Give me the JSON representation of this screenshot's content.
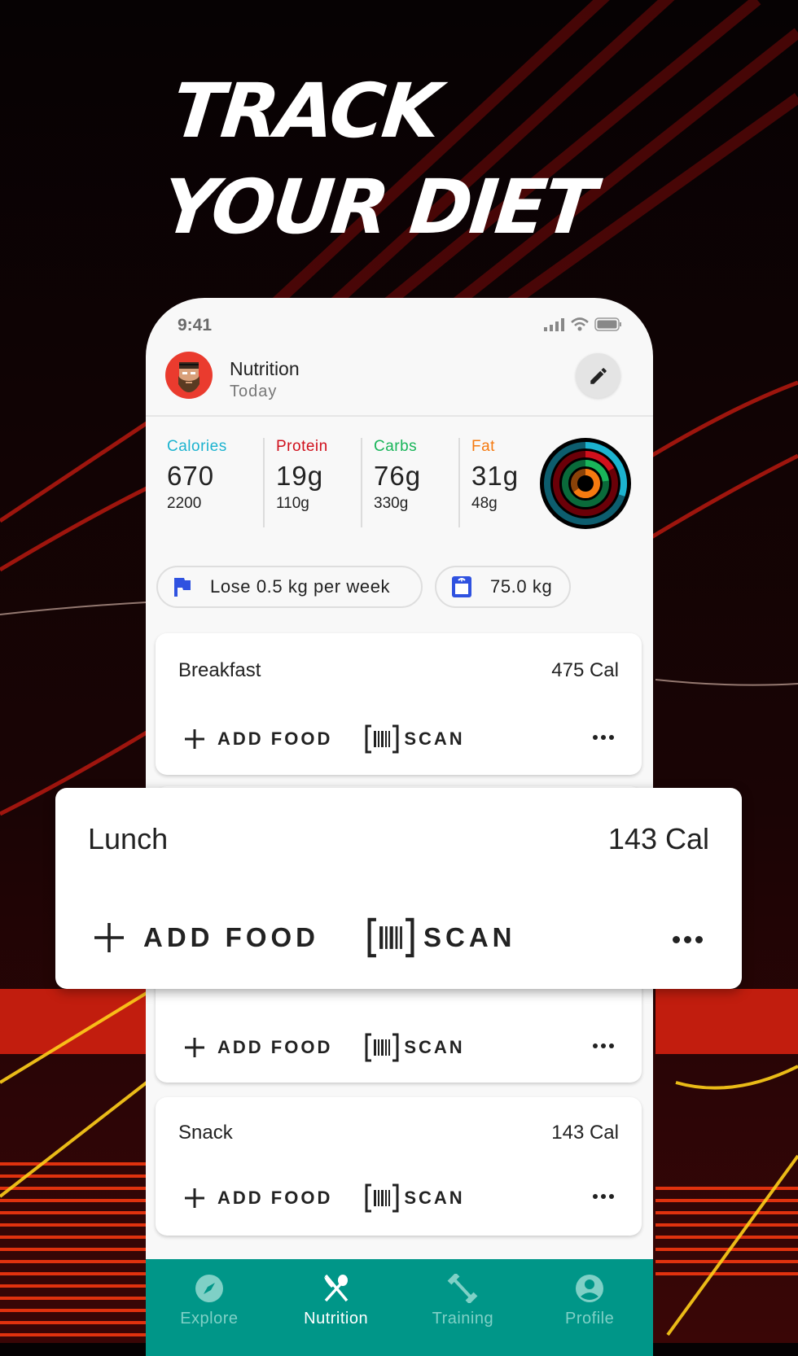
{
  "headline": {
    "line1": "TRACK",
    "line2": "YOUR DIET"
  },
  "status_bar": {
    "time": "9:41",
    "icons": [
      "signal-icon",
      "wifi-icon",
      "battery-icon"
    ]
  },
  "header": {
    "title": "Nutrition",
    "subtitle": "Today",
    "edit_icon": "pencil-icon"
  },
  "stats": [
    {
      "label": "Calories",
      "value": "670",
      "goal": "2200",
      "color": "#1cb3cf",
      "progress": 0.3
    },
    {
      "label": "Protein",
      "value": "19g",
      "goal": "110g",
      "color": "#d0101c",
      "progress": 0.17
    },
    {
      "label": "Carbs",
      "value": "76g",
      "goal": "330g",
      "color": "#19b55a",
      "progress": 0.23
    },
    {
      "label": "Fat",
      "value": "31g",
      "goal": "48g",
      "color": "#f57a10",
      "progress": 0.65
    }
  ],
  "chips": {
    "goal": {
      "label": "Lose 0.5 kg per week",
      "icon": "flag-icon"
    },
    "weight": {
      "label": "75.0 kg",
      "icon": "scale-icon"
    },
    "icon_color": "#2f52e0"
  },
  "meals": [
    {
      "name": "Breakfast",
      "calories": "475 Cal"
    },
    {
      "name": "Lunch",
      "calories": "143 Cal"
    },
    {
      "name": "",
      "calories": ""
    },
    {
      "name": "Snack",
      "calories": "143 Cal"
    }
  ],
  "actions": {
    "add_food": "ADD FOOD",
    "scan": "SCAN"
  },
  "nav": {
    "items": [
      {
        "label": "Explore",
        "icon": "compass-icon",
        "active": false
      },
      {
        "label": "Nutrition",
        "icon": "fork-spoon-icon",
        "active": true
      },
      {
        "label": "Training",
        "icon": "dumbbell-icon",
        "active": false
      },
      {
        "label": "Profile",
        "icon": "account-icon",
        "active": false
      }
    ],
    "color": "#009688"
  }
}
